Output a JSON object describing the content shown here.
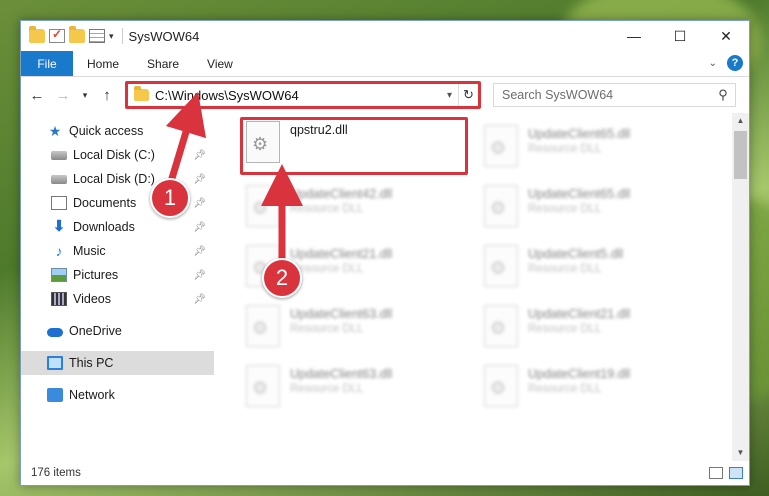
{
  "window": {
    "title": "SysWOW64",
    "controls": {
      "minimize": "—",
      "maximize": "☐",
      "close": "✕"
    }
  },
  "ribbon": {
    "file_tab": "File",
    "tabs": [
      "Home",
      "Share",
      "View"
    ]
  },
  "address": {
    "path": "C:\\Windows\\SysWOW64",
    "search_placeholder": "Search SysWOW64"
  },
  "nav": {
    "quick_access": "Quick access",
    "pinned": [
      {
        "label": "Local Disk (C:)",
        "icon": "drive-icon"
      },
      {
        "label": "Local Disk (D:)",
        "icon": "drive-icon"
      },
      {
        "label": "Documents",
        "icon": "documents-icon"
      },
      {
        "label": "Downloads",
        "icon": "downloads-icon"
      },
      {
        "label": "Music",
        "icon": "music-icon"
      },
      {
        "label": "Pictures",
        "icon": "pictures-icon"
      },
      {
        "label": "Videos",
        "icon": "videos-icon"
      }
    ],
    "onedrive": "OneDrive",
    "this_pc": "This PC",
    "network": "Network"
  },
  "files": {
    "highlighted": {
      "name": "qpstru2.dll"
    },
    "left_column": [
      {
        "name": "UpdateClient42.dll",
        "type": "Resource DLL"
      },
      {
        "name": "UpdateClient21.dll",
        "type": "Resource DLL"
      },
      {
        "name": "UpdateClient63.dll",
        "type": "Resource DLL"
      },
      {
        "name": "UpdateClient63.dll",
        "type": "Resource DLL"
      }
    ],
    "right_column": [
      {
        "name": "UpdateClient65.dll",
        "type": "Resource DLL"
      },
      {
        "name": "UpdateClient65.dll",
        "type": "Resource DLL"
      },
      {
        "name": "UpdateClient5.dll",
        "type": "Resource DLL"
      },
      {
        "name": "UpdateClient21.dll",
        "type": "Resource DLL"
      },
      {
        "name": "UpdateClient19.dll",
        "type": "Resource DLL"
      }
    ]
  },
  "callouts": {
    "one": "1",
    "two": "2",
    "color": "#d9343e"
  },
  "status": {
    "item_count": "176 items"
  }
}
